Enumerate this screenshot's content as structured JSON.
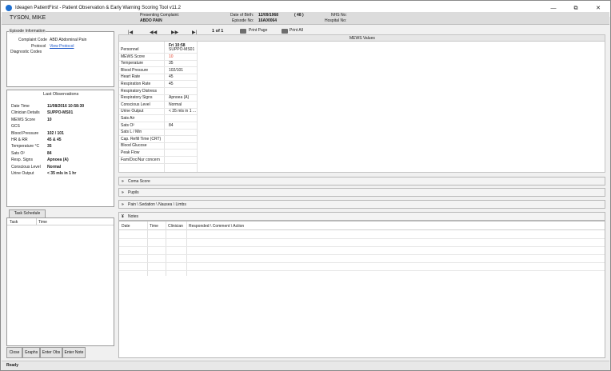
{
  "window": {
    "title": "Ideagen PatientFirst - Patient Observation & Early Warning Scoring Tool v11.2",
    "controls": [
      "—",
      "⧉",
      "✕"
    ]
  },
  "patient": {
    "name": "TYSON, MIKE",
    "presenting_complaint_label": "Presenting Complaint:",
    "presenting_complaint": "ABDO PAIN",
    "dob_label": "Date of Birth:",
    "dob": "12/09/1968",
    "age": "( 48 )",
    "episode_label": "Episode No:",
    "episode": "16A00064",
    "nhs_label": "NHS No:",
    "nhs": "",
    "hospital_label": "Hospital No:",
    "hospital": ""
  },
  "episode_info": {
    "title": "Episode Information",
    "complaint_code_label": "Complaint Code",
    "complaint_code": "ABD Abdominal Pain",
    "protocol_label": "Protocol",
    "protocol_link": "View Protocol",
    "diagnostic_label": "Diagnostic Codes"
  },
  "last_obs": {
    "title": "Last Observations",
    "rows": [
      {
        "label": "Date Time",
        "value": "11/08/2016 10:58:30"
      },
      {
        "label": "Clinician Details",
        "value": "SUPPO-MS01"
      },
      {
        "label": "MEWS Score",
        "value": "10"
      },
      {
        "label": "GCS",
        "value": ""
      },
      {
        "label": "Blood Pressure",
        "value": "102 / 101"
      },
      {
        "label": "HR & RR",
        "value": "45 & 45"
      },
      {
        "label": "Temperature °C",
        "value": "35"
      },
      {
        "label": "Sats O²",
        "value": "84"
      },
      {
        "label": "Resp. Signs",
        "value": "Apnoea (A)"
      },
      {
        "label": "Conscious Level",
        "value": "Normal"
      },
      {
        "label": "Urine Output",
        "value": "< 35 mls in 1 hr"
      }
    ]
  },
  "task": {
    "schedule_button": "Task Schedule",
    "col_task": "Task",
    "col_time": "Time"
  },
  "bottom_buttons": [
    "Close",
    "Graphs",
    "Enter Obs",
    "Enter Note"
  ],
  "nav": {
    "first": "|◀",
    "prev": "◀◀",
    "next": "▶▶",
    "last": "▶|",
    "page": "1 of 1",
    "print_page": "Print Page",
    "print_all": "Print All"
  },
  "mews": {
    "title": "MEWS Values",
    "column": "Fri 10:58",
    "rows": [
      {
        "label": "Personnel",
        "value": "SUPPO-MS01"
      },
      {
        "label": "MEWS Score",
        "value": "10",
        "alert": true
      },
      {
        "label": "Temperature",
        "value": "35"
      },
      {
        "label": "Blood Pressure",
        "value": "102/101"
      },
      {
        "label": "Heart Rate",
        "value": "45"
      },
      {
        "label": "Respiration Rate",
        "value": "45"
      },
      {
        "label": "Respiratory Distress",
        "value": ""
      },
      {
        "label": "Respiratory Signs",
        "value": "Apnoea (A)"
      },
      {
        "label": "Conscious Level",
        "value": "Normal"
      },
      {
        "label": "Urine Output",
        "value": "< 35 mls in 1 ..."
      },
      {
        "label": "Sats Air",
        "value": ""
      },
      {
        "label": "Sats O²",
        "value": "84"
      },
      {
        "label": "Sats L / Min",
        "value": ""
      },
      {
        "label": "Cap. Refill Time (CRT)",
        "value": ""
      },
      {
        "label": "Blood Glucose",
        "value": ""
      },
      {
        "label": "Peak Flow",
        "value": ""
      },
      {
        "label": "Fam/Doc/Nur concern",
        "value": ""
      }
    ],
    "alert_color": "#e0412b"
  },
  "sections": {
    "coma": "Coma Score",
    "pupils": "Pupils",
    "pain": "Pain \\ Sedation \\ Nausea \\ Limbs",
    "notes": "Notes"
  },
  "notes_columns": [
    "Date",
    "Time",
    "Clinician",
    "Responded \\ Comment \\ Action"
  ],
  "status_text": "Ready"
}
